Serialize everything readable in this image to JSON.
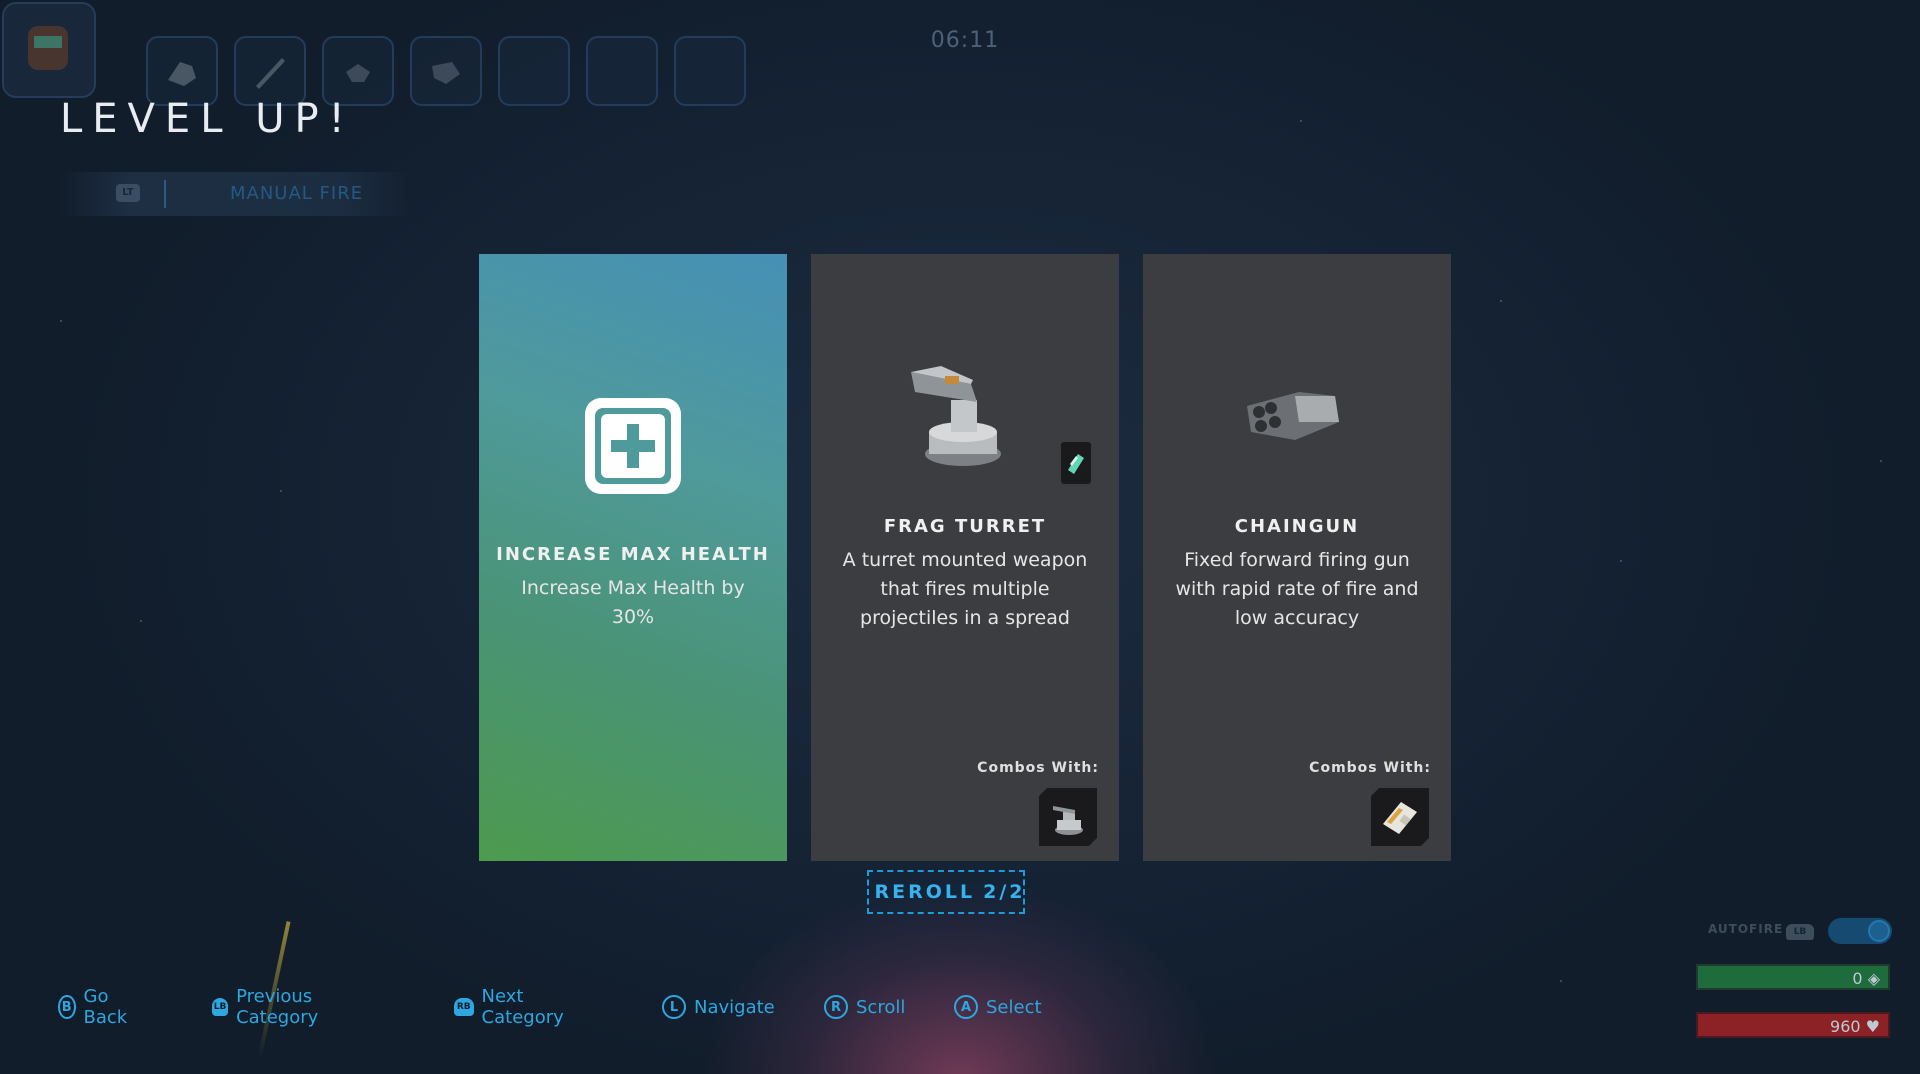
{
  "hud": {
    "timer": "06:11",
    "equipped_slots": [
      {
        "icon": "frag-turret-icon"
      },
      {
        "icon": "rifle-icon"
      },
      {
        "icon": "drone-icon"
      },
      {
        "icon": "chaingun-icon"
      },
      {
        "icon": ""
      },
      {
        "icon": ""
      },
      {
        "icon": ""
      }
    ]
  },
  "header": {
    "title": "LEVEL UP!",
    "category_button": "LT",
    "category_label": "MANUAL FIRE"
  },
  "cards": [
    {
      "title": "INCREASE MAX HEALTH",
      "description": "Increase Max Health by 30%",
      "icon": "health-plus-icon",
      "selected": true
    },
    {
      "title": "FRAG TURRET",
      "description": "A turret mounted weapon that fires multiple projectiles in a spread",
      "icon": "frag-turret-icon",
      "combos_label": "Combos With:",
      "combo_icon": "turret-combo-icon"
    },
    {
      "title": "CHAINGUN",
      "description": "Fixed forward firing gun with rapid rate of fire and low accuracy",
      "icon": "chaingun-icon",
      "combos_label": "Combos With:",
      "combo_icon": "ammo-combo-icon"
    }
  ],
  "reroll": {
    "label": "REROLL",
    "count": "2/2"
  },
  "controls": [
    {
      "button": "B",
      "label": "Go Back"
    },
    {
      "button": "LB",
      "label": "Previous Category"
    },
    {
      "button": "RB",
      "label": "Next Category"
    },
    {
      "button": "L",
      "label": "Navigate"
    },
    {
      "button": "R",
      "label": "Scroll"
    },
    {
      "button": "A",
      "label": "Select"
    }
  ],
  "status": {
    "autofire_label": "AUTOFIRE",
    "autofire_button": "LB",
    "autofire_on": true,
    "shield_value": "0",
    "health_value": "960"
  },
  "colors": {
    "accent": "#2ea6e0",
    "card_bg": "#3b3d40",
    "selected_gradient_top": "#4690b6",
    "selected_gradient_bottom": "#4d9a4e",
    "shield_bar": "#1e6b3c",
    "health_bar": "#8c2226"
  }
}
